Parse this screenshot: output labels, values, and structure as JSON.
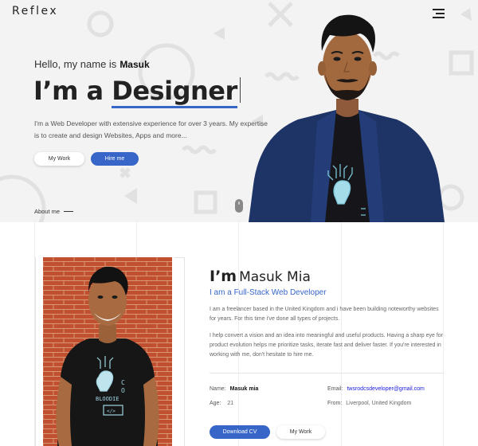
{
  "header": {
    "logo": "Reflex",
    "menu_icon": "hamburger-menu-icon"
  },
  "hero": {
    "greeting": "Hello, my name is",
    "name": "Masuk",
    "headline_prefix": "I’m a",
    "headline_role": "Designer",
    "intro": "I'm a Web Developer with extensive experience for over 3 years. My expertise is to create and design Websites, Apps and more...",
    "buttons": {
      "my_work": "My Work",
      "hire_me": "Hire me"
    },
    "about_link": "About me",
    "scroll_icon": "mouse-scroll-icon"
  },
  "about": {
    "im": "I’m",
    "full_name": "Masuk Mia",
    "role": "I am a Full-Stack Web Developer",
    "para1": "I am a freelancer based in the United Kingdom and i have been building noteworthy websites for years. For this time i've done all types of projects.",
    "para2": "I help convert a vision and an idea into meaningful and useful products. Having a sharp eye for product evolution helps me prioritize tasks, iterate fast and deliver faster. If you're interested in working with me, don't hesitate to hire me.",
    "details": {
      "name_label": "Name:",
      "name_value": "Masuk mia",
      "age_label": "Age:",
      "age_value": "21",
      "email_label": "Email:",
      "email_value": "twsrodcsdeveloper@gmail.com",
      "from_label": "From:",
      "from_value": "Liverpool, United Kingdom"
    },
    "buttons": {
      "download_cv": "Download CV",
      "my_work": "My Work"
    }
  },
  "colors": {
    "accent": "#3766c8",
    "hero_bg": "#f3f3f3",
    "brick": "#c0502f"
  }
}
